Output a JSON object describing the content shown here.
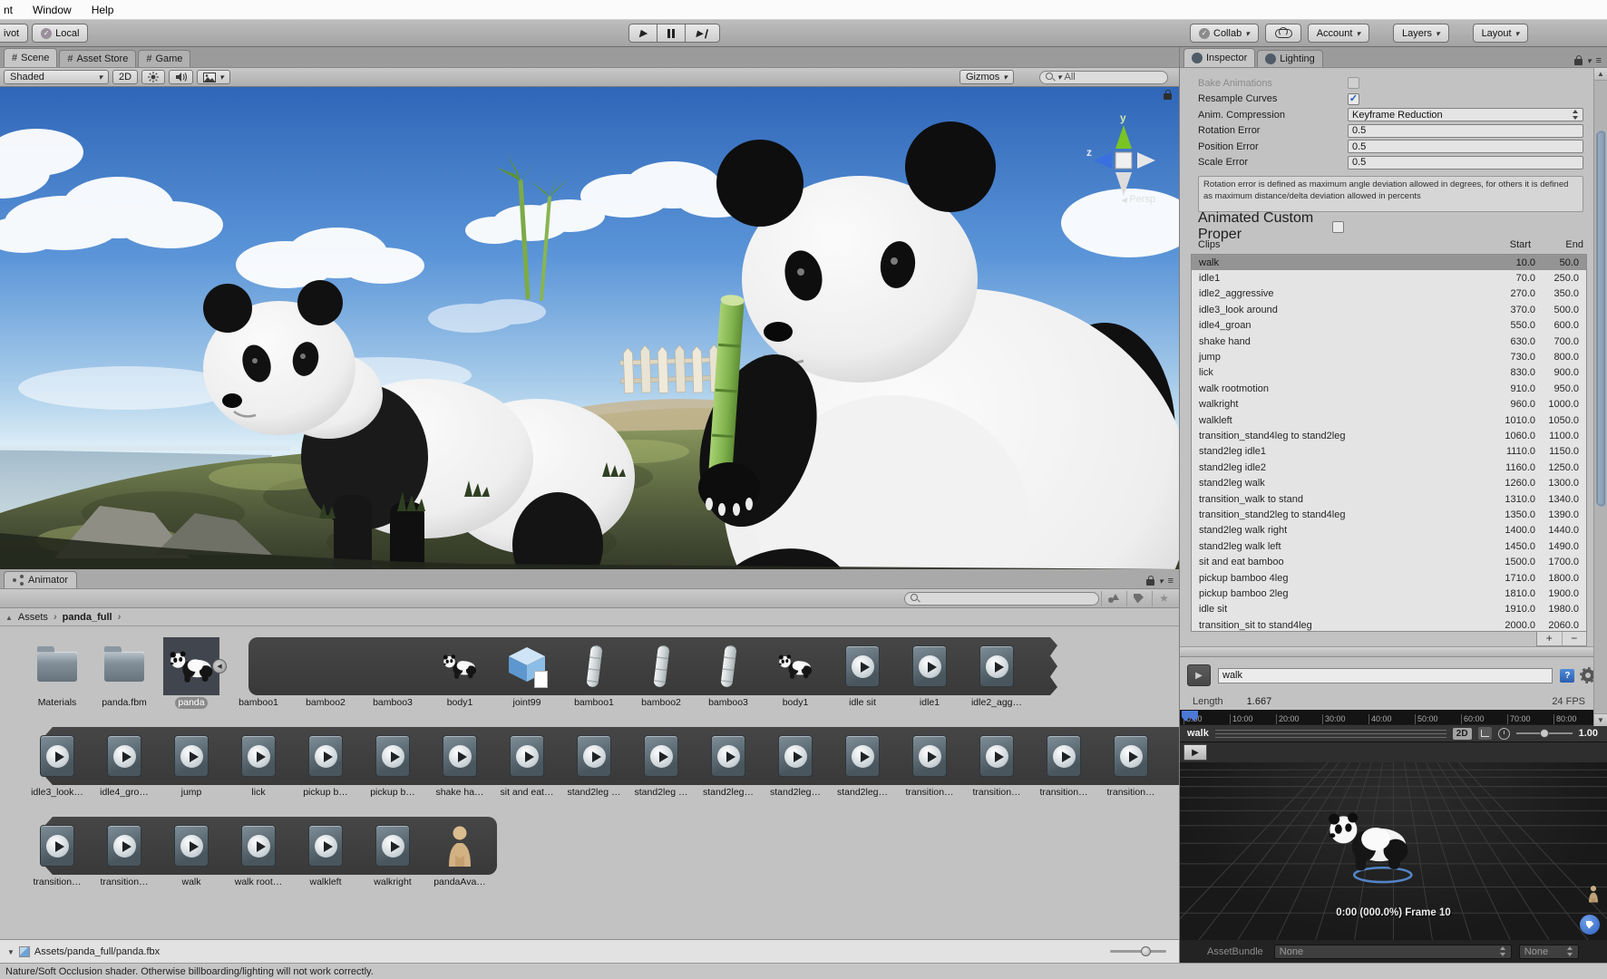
{
  "menu": {
    "items": [
      "nt",
      "Window",
      "Help"
    ]
  },
  "toolbar": {
    "pivot": "ivot",
    "local": "Local",
    "collab": "Collab",
    "account": "Account",
    "layers": "Layers",
    "layout": "Layout"
  },
  "scene_panel": {
    "tabs": [
      {
        "label": "Scene",
        "active": true
      },
      {
        "label": "Asset Store",
        "active": false
      },
      {
        "label": "Game",
        "active": false
      }
    ],
    "shaded": "Shaded",
    "two_d": "2D",
    "gizmos": "Gizmos",
    "search_value": "All",
    "axis": {
      "y": "y",
      "z": "z",
      "persp": "Persp"
    }
  },
  "animator_panel": {
    "tab": "Animator"
  },
  "project": {
    "breadcrumb": {
      "root": "Assets",
      "current": "panda_full"
    },
    "rows": [
      {
        "items": [
          {
            "label": "Materials",
            "icon": "folder"
          },
          {
            "label": "panda.fbm",
            "icon": "folder"
          },
          {
            "label": "panda",
            "icon": "panda-model",
            "selected": true
          },
          {
            "label": "bamboo1",
            "icon": "blank"
          },
          {
            "label": "bamboo2",
            "icon": "blank"
          },
          {
            "label": "bamboo3",
            "icon": "blank"
          },
          {
            "label": "body1",
            "icon": "panda-small"
          },
          {
            "label": "joint99",
            "icon": "cube"
          },
          {
            "label": "bamboo1",
            "icon": "bamboo"
          },
          {
            "label": "bamboo2",
            "icon": "bamboo"
          },
          {
            "label": "bamboo3",
            "icon": "bamboo"
          },
          {
            "label": "body1",
            "icon": "panda-small"
          },
          {
            "label": "idle sit",
            "icon": "anim-clip"
          },
          {
            "label": "idle1",
            "icon": "anim-clip"
          },
          {
            "label": "idle2_agg…",
            "icon": "anim-clip"
          }
        ]
      },
      {
        "items": [
          {
            "label": "idle3_look…",
            "icon": "anim-clip"
          },
          {
            "label": "idle4_gro…",
            "icon": "anim-clip"
          },
          {
            "label": "jump",
            "icon": "anim-clip"
          },
          {
            "label": "lick",
            "icon": "anim-clip"
          },
          {
            "label": "pickup b…",
            "icon": "anim-clip"
          },
          {
            "label": "pickup b…",
            "icon": "anim-clip"
          },
          {
            "label": "shake ha…",
            "icon": "anim-clip"
          },
          {
            "label": "sit and eat…",
            "icon": "anim-clip"
          },
          {
            "label": "stand2leg …",
            "icon": "anim-clip"
          },
          {
            "label": "stand2leg …",
            "icon": "anim-clip"
          },
          {
            "label": "stand2leg…",
            "icon": "anim-clip"
          },
          {
            "label": "stand2leg…",
            "icon": "anim-clip"
          },
          {
            "label": "stand2leg…",
            "icon": "anim-clip"
          },
          {
            "label": "transition…",
            "icon": "anim-clip"
          },
          {
            "label": "transition…",
            "icon": "anim-clip"
          },
          {
            "label": "transition…",
            "icon": "anim-clip"
          },
          {
            "label": "transition…",
            "icon": "anim-clip"
          }
        ]
      },
      {
        "items": [
          {
            "label": "transition…",
            "icon": "anim-clip"
          },
          {
            "label": "transition…",
            "icon": "anim-clip"
          },
          {
            "label": "walk",
            "icon": "anim-clip"
          },
          {
            "label": "walk root…",
            "icon": "anim-clip"
          },
          {
            "label": "walkleft",
            "icon": "anim-clip"
          },
          {
            "label": "walkright",
            "icon": "anim-clip"
          },
          {
            "label": "pandaAva…",
            "icon": "avatar"
          }
        ]
      }
    ],
    "footer_path": "Assets/panda_full/panda.fbx"
  },
  "status_bar": {
    "message": "Nature/Soft Occlusion shader. Otherwise billboarding/lighting will not work correctly."
  },
  "inspector": {
    "tabs": [
      {
        "label": "Inspector",
        "active": true
      },
      {
        "label": "Lighting",
        "active": false
      }
    ],
    "properties": {
      "bake_animations": {
        "label": "Bake Animations",
        "checked": false
      },
      "resample_curves": {
        "label": "Resample Curves",
        "checked": true
      },
      "anim_compression": {
        "label": "Anim. Compression",
        "value": "Keyframe Reduction"
      },
      "rotation_error": {
        "label": "Rotation Error",
        "value": "0.5"
      },
      "position_error": {
        "label": "Position Error",
        "value": "0.5"
      },
      "scale_error": {
        "label": "Scale Error",
        "value": "0.5"
      }
    },
    "help_text": "Rotation error is defined as maximum angle deviation allowed in degrees, for others it is defined as maximum distance/delta deviation allowed in percents",
    "animated_custom": {
      "label": "Animated Custom Proper",
      "checked": false
    },
    "clips": {
      "columns": {
        "name": "Clips",
        "start": "Start",
        "end": "End"
      },
      "add_label": "+",
      "remove_label": "−",
      "rows": [
        {
          "name": "walk",
          "start": "10.0",
          "end": "50.0",
          "selected": true
        },
        {
          "name": "idle1",
          "start": "70.0",
          "end": "250.0"
        },
        {
          "name": "idle2_aggressive",
          "start": "270.0",
          "end": "350.0"
        },
        {
          "name": "idle3_look around",
          "start": "370.0",
          "end": "500.0"
        },
        {
          "name": "idle4_groan",
          "start": "550.0",
          "end": "600.0"
        },
        {
          "name": "shake hand",
          "start": "630.0",
          "end": "700.0"
        },
        {
          "name": "jump",
          "start": "730.0",
          "end": "800.0"
        },
        {
          "name": "lick",
          "start": "830.0",
          "end": "900.0"
        },
        {
          "name": "walk rootmotion",
          "start": "910.0",
          "end": "950.0"
        },
        {
          "name": "walkright",
          "start": "960.0",
          "end": "1000.0"
        },
        {
          "name": "walkleft",
          "start": "1010.0",
          "end": "1050.0"
        },
        {
          "name": "transition_stand4leg to stand2leg",
          "start": "1060.0",
          "end": "1100.0"
        },
        {
          "name": "stand2leg idle1",
          "start": "1110.0",
          "end": "1150.0"
        },
        {
          "name": "stand2leg idle2",
          "start": "1160.0",
          "end": "1250.0"
        },
        {
          "name": "stand2leg walk",
          "start": "1260.0",
          "end": "1300.0"
        },
        {
          "name": "transition_walk to stand",
          "start": "1310.0",
          "end": "1340.0"
        },
        {
          "name": "transition_stand2leg to stand4leg",
          "start": "1350.0",
          "end": "1390.0"
        },
        {
          "name": "stand2leg walk right",
          "start": "1400.0",
          "end": "1440.0"
        },
        {
          "name": "stand2leg walk left",
          "start": "1450.0",
          "end": "1490.0"
        },
        {
          "name": "sit and eat bamboo",
          "start": "1500.0",
          "end": "1700.0"
        },
        {
          "name": "pickup bamboo 4leg",
          "start": "1710.0",
          "end": "1800.0"
        },
        {
          "name": "pickup bamboo 2leg",
          "start": "1810.0",
          "end": "1900.0"
        },
        {
          "name": "idle sit",
          "start": "1910.0",
          "end": "1980.0"
        },
        {
          "name": "transition_sit to stand4leg",
          "start": "2000.0",
          "end": "2060.0"
        }
      ]
    },
    "clip_field": {
      "value": "walk"
    },
    "info": {
      "length_label": "Length",
      "length": "1.667",
      "fps": "24 FPS"
    },
    "ruler_ticks": [
      "0:00",
      "10:00",
      "20:00",
      "30:00",
      "40:00",
      "50:00",
      "60:00",
      "70:00",
      "80:00"
    ],
    "preview_bar": {
      "clip": "walk",
      "two_d": "2D",
      "speed": "1.00"
    },
    "preview": {
      "overlay": "0:00 (000.0%) Frame 10"
    },
    "asset_bundle": {
      "label": "AssetBundle",
      "bundle": "None",
      "variant": "None"
    }
  }
}
